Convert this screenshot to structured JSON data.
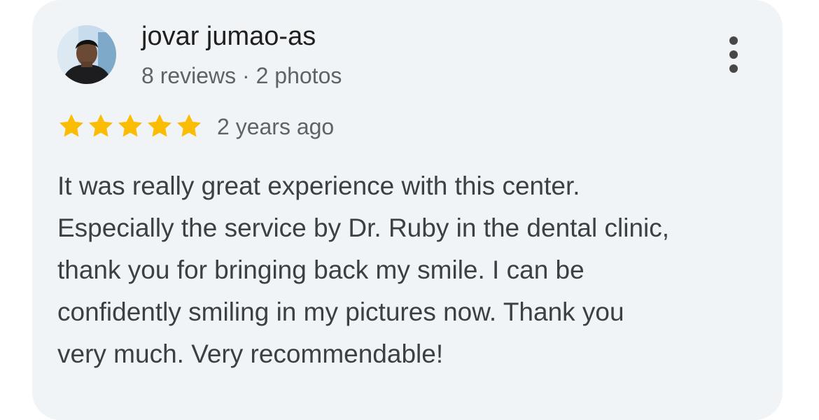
{
  "review": {
    "author_name": "jovar jumao-as",
    "author_meta": "8 reviews · 2 photos",
    "rating": 5,
    "rating_max": 5,
    "time_ago": "2 years ago",
    "text_lines": [
      "It was really great experience with this center.",
      "Especially the service by Dr. Ruby in the dental clinic,",
      "thank you for bringing back my smile. I can be",
      "confidently smiling in my pictures now. Thank you",
      "very much. Very recommendable!"
    ]
  },
  "icons": {
    "menu": "more-vert-icon",
    "star": "star-icon",
    "avatar": "user-avatar-photo"
  },
  "colors": {
    "card_bg": "#f1f4f6",
    "star": "#fbbc04",
    "name": "#1f1f1f",
    "secondary": "#5f6368",
    "body_text": "#3c4043"
  }
}
